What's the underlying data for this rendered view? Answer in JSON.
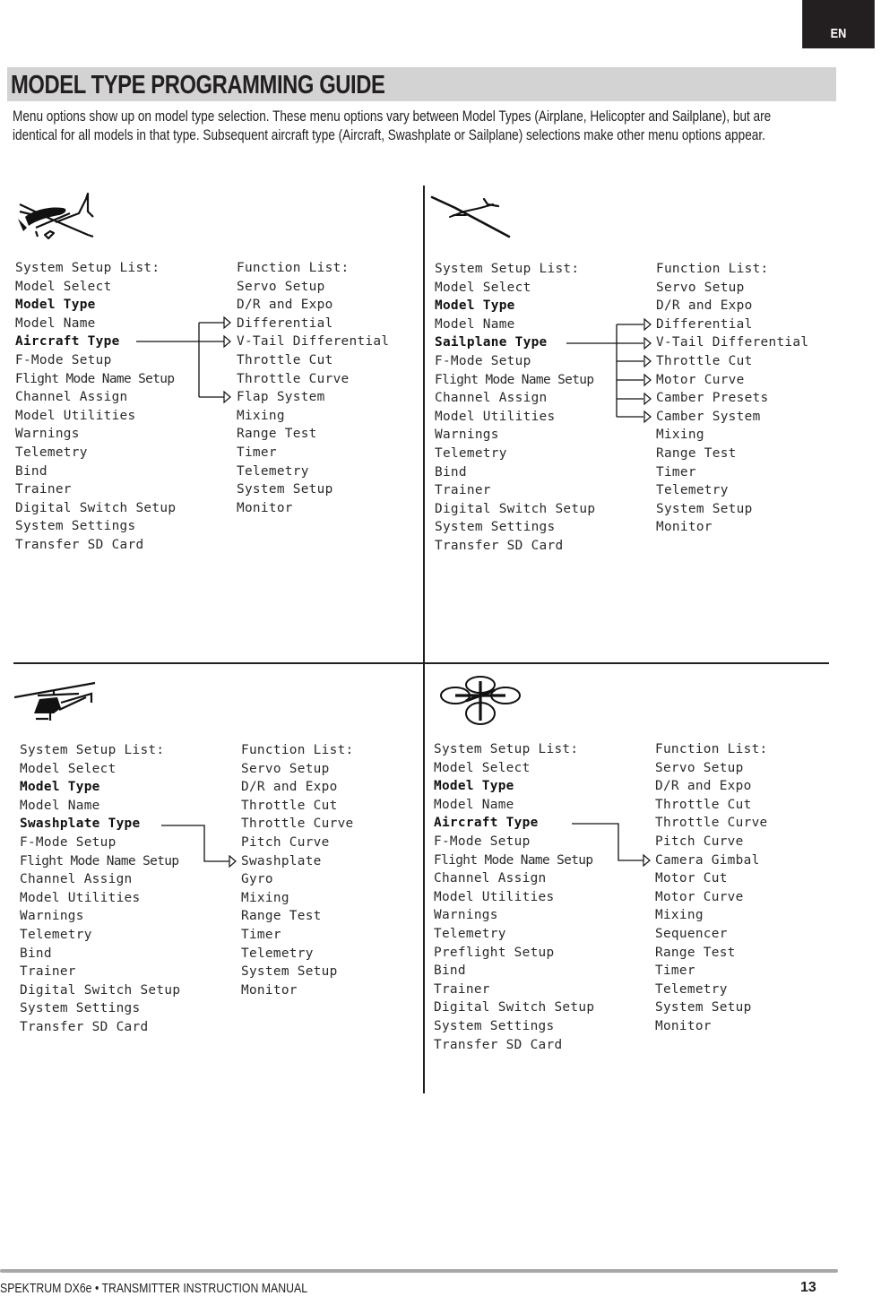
{
  "language_tab": "EN",
  "section_title": "MODEL TYPE PROGRAMMING GUIDE",
  "intro_text": "Menu options show up on model type selection. These menu options vary between Model Types (Airplane, Helicopter and Sailplane), but are identical for all models in that type. Subsequent aircraft type (Aircraft, Swashplate or Sailplane) selections make other menu options appear.",
  "panels": [
    {
      "model": "airplane",
      "icon": "airplane-icon",
      "system_setup": {
        "heading": "System Setup List:",
        "items": [
          "Model Select",
          "Model Type",
          "Model Name",
          "Aircraft Type",
          "F-Mode Setup",
          "Flight Mode Name Setup",
          "Channel Assign",
          "Model Utilities",
          "Warnings",
          "Telemetry",
          "Bind",
          "Trainer",
          "Digital Switch Setup",
          "System Settings",
          "Transfer SD Card"
        ],
        "highlighted": [
          "Model Type",
          "Aircraft Type"
        ]
      },
      "function_list": {
        "heading": "Function List:",
        "items": [
          "Servo Setup",
          "D/R and Expo",
          "Differential",
          "V-Tail Differential",
          "Throttle Cut",
          "Throttle Curve",
          "Flap System",
          "Mixing",
          "Range Test",
          "Timer",
          "Telemetry",
          "System Setup",
          "Monitor"
        ],
        "linked_from_type": [
          "Differential",
          "V-Tail Differential",
          "Flap System"
        ]
      }
    },
    {
      "model": "sailplane",
      "icon": "sailplane-icon",
      "system_setup": {
        "heading": "System Setup List:",
        "items": [
          "Model Select",
          "Model Type",
          "Model Name",
          "Sailplane Type",
          "F-Mode Setup",
          "Flight Mode Name Setup",
          "Channel Assign",
          "Model Utilities",
          "Warnings",
          "Telemetry",
          "Bind",
          "Trainer",
          "Digital Switch Setup",
          "System Settings",
          "Transfer SD Card"
        ],
        "highlighted": [
          "Model Type",
          "Sailplane Type"
        ]
      },
      "function_list": {
        "heading": "Function List:",
        "items": [
          "Servo Setup",
          "D/R and Expo",
          "Differential",
          "V-Tail Differential",
          "Throttle Cut",
          "Motor Curve",
          "Camber Presets",
          "Camber System",
          "Mixing",
          "Range Test",
          "Timer",
          "Telemetry",
          "System Setup",
          "Monitor"
        ],
        "linked_from_type": [
          "Differential",
          "V-Tail Differential",
          "Throttle Cut",
          "Motor Curve",
          "Camber Presets",
          "Camber System"
        ]
      }
    },
    {
      "model": "helicopter",
      "icon": "helicopter-icon",
      "system_setup": {
        "heading": "System Setup List:",
        "items": [
          "Model Select",
          "Model Type",
          "Model Name",
          "Swashplate Type",
          "F-Mode Setup",
          "Flight Mode Name Setup",
          "Channel Assign",
          "Model Utilities",
          "Warnings",
          "Telemetry",
          "Bind",
          "Trainer",
          "Digital Switch Setup",
          "System Settings",
          "Transfer SD Card"
        ],
        "highlighted": [
          "Model Type",
          "Swashplate Type"
        ]
      },
      "function_list": {
        "heading": "Function List:",
        "items": [
          "Servo Setup",
          "D/R and Expo",
          "Throttle Cut",
          "Throttle Curve",
          "Pitch Curve",
          "Swashplate",
          "Gyro",
          "Mixing",
          "Range Test",
          "Timer",
          "Telemetry",
          "System Setup",
          "Monitor"
        ],
        "linked_from_type": [
          "Swashplate"
        ]
      }
    },
    {
      "model": "multirotor",
      "icon": "multirotor-icon",
      "system_setup": {
        "heading": "System Setup List:",
        "items": [
          "Model Select",
          "Model Type",
          "Model Name",
          "Aircraft Type",
          "F-Mode Setup",
          "Flight Mode Name Setup",
          "Channel Assign",
          "Model Utilities",
          "Warnings",
          "Telemetry",
          "Preflight Setup",
          "Bind",
          "Trainer",
          "Digital Switch Setup",
          "System Settings",
          "Transfer SD Card"
        ],
        "highlighted": [
          "Model Type",
          "Aircraft Type"
        ]
      },
      "function_list": {
        "heading": "Function List:",
        "items": [
          "Servo Setup",
          "D/R and Expo",
          "Throttle Cut",
          "Throttle Curve",
          "Pitch Curve",
          "Camera Gimbal",
          "Motor Cut",
          "Motor Curve",
          "Mixing",
          "Sequencer",
          "Range Test",
          "Timer",
          "Telemetry",
          "System Setup",
          "Monitor"
        ],
        "linked_from_type": [
          "Camera Gimbal"
        ]
      }
    }
  ],
  "footer": {
    "manual_title": "SPEKTRUM DX6e • TRANSMITTER INSTRUCTION MANUAL",
    "page_number": "13"
  }
}
